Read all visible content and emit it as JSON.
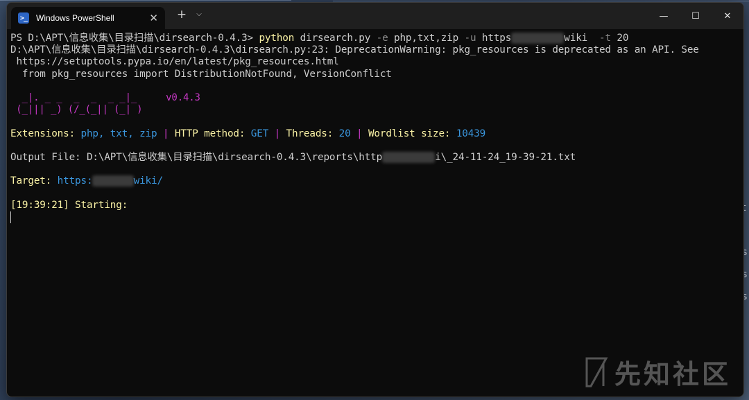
{
  "window": {
    "tab_title": "Windows PowerShell",
    "tab_icon_glyph": ">_",
    "close_tab": "✕",
    "new_tab": "+",
    "dropdown": "⌵",
    "minimize": "—",
    "maximize": "☐",
    "close": "✕"
  },
  "terminal": {
    "prompt": "PS D:\\APT\\信息收集\\目录扫描\\dirsearch-0.4.3> ",
    "command_python": "python",
    "command_args_a": " dirsearch.py ",
    "flag_e": "-e",
    "ext_arg": " php,txt,zip ",
    "flag_u": "-u",
    "url_arg_a": " https",
    "url_arg_b": "wiki  ",
    "flag_t": "-t",
    "threads_arg": " 20",
    "warn_line1": "D:\\APT\\信息收集\\目录扫描\\dirsearch-0.4.3\\dirsearch.py:23: DeprecationWarning: pkg_resources is deprecated as an API. See",
    "warn_line2": " https://setuptools.pypa.io/en/latest/pkg_resources.html",
    "warn_line3": "  from pkg_resources import DistributionNotFound, VersionConflict",
    "logo_top": "  _|. _ _  _  _  _ _|_",
    "logo_bottom": " (_||| _) (/_(_|| (_| )",
    "version": "v0.4.3",
    "ext_label": "Extensions: ",
    "ext_value": "php, txt, zip",
    "sep": " | ",
    "method_label": "HTTP method: ",
    "method_value": "GET",
    "threads_label": "Threads: ",
    "threads_value": "20",
    "wordlist_label": "Wordlist size: ",
    "wordlist_value": "10439",
    "output_a": "Output File: D:\\APT\\信息收集\\目录扫描\\dirsearch-0.4.3\\reports\\http",
    "output_b": "i\\_24-11-24_19-39-21.txt",
    "target_label": "Target: ",
    "target_a": "https:",
    "target_b": "wiki/",
    "starting": "[19:39:21] Starting:"
  },
  "watermark": {
    "text": "先知社区"
  },
  "colors": {
    "background": "#0c0c0c",
    "foreground": "#cccccc",
    "cyan": "#3a96dd",
    "yellow": "#f9f1a5",
    "magenta": "#c838c6"
  }
}
